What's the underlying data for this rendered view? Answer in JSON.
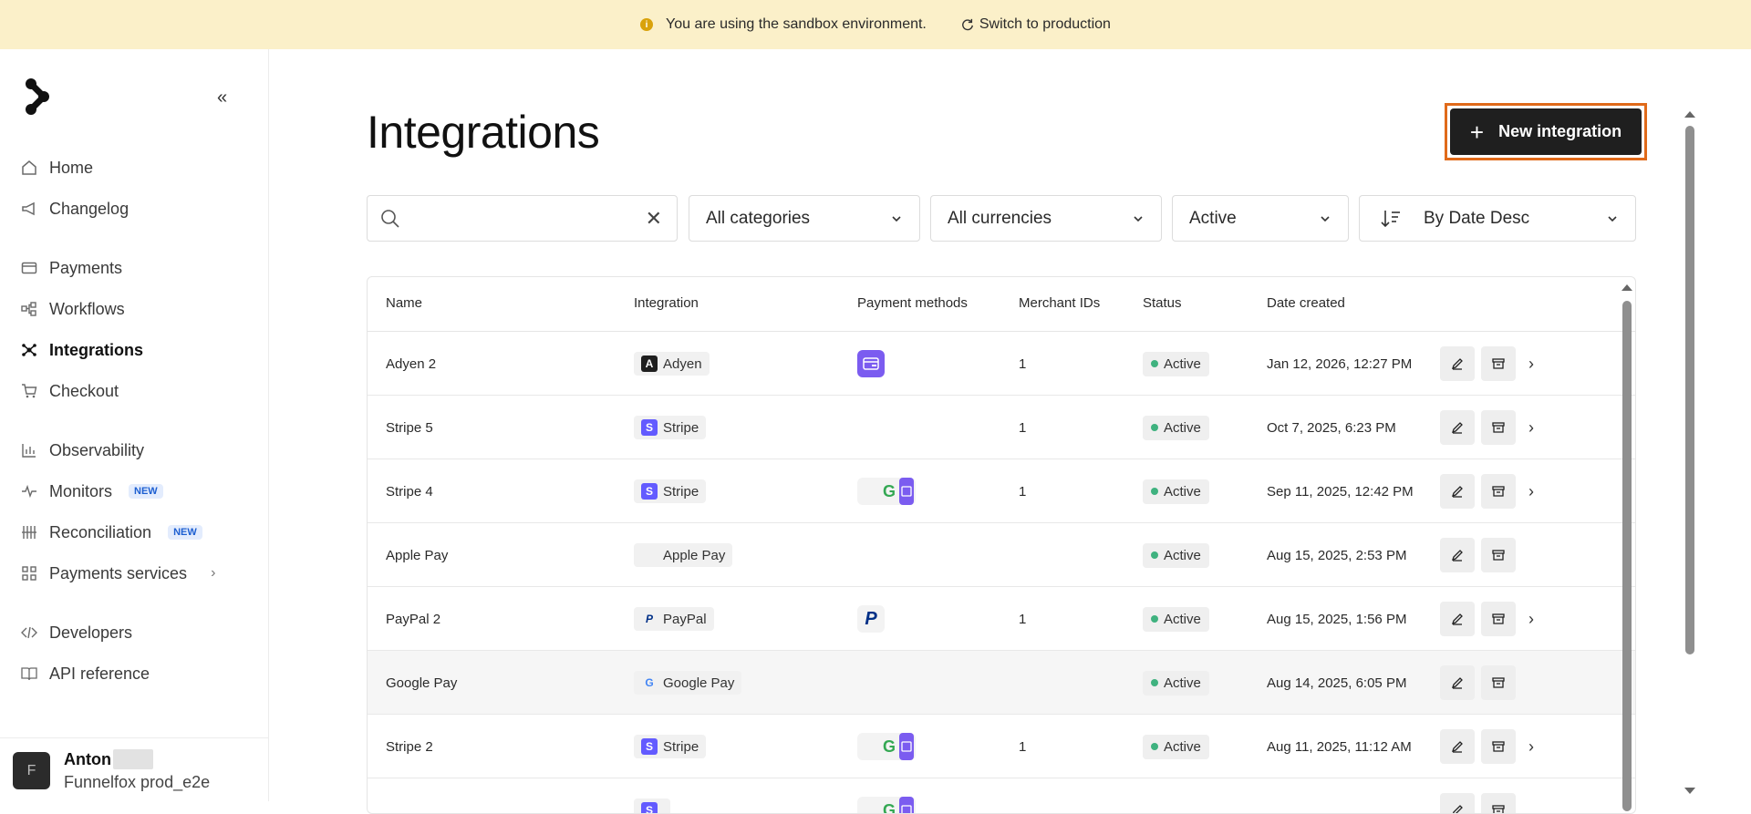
{
  "banner": {
    "message": "You are using the sandbox environment.",
    "switch_label": "Switch to production"
  },
  "sidebar": {
    "items": [
      {
        "label": "Home",
        "icon": "home-icon"
      },
      {
        "label": "Changelog",
        "icon": "megaphone-icon"
      },
      {
        "label": "Payments",
        "icon": "card-icon"
      },
      {
        "label": "Workflows",
        "icon": "workflow-icon"
      },
      {
        "label": "Integrations",
        "icon": "integrations-icon",
        "active": true
      },
      {
        "label": "Checkout",
        "icon": "cart-icon"
      },
      {
        "label": "Observability",
        "icon": "chart-icon"
      },
      {
        "label": "Monitors",
        "icon": "pulse-icon",
        "badge": "NEW"
      },
      {
        "label": "Reconciliation",
        "icon": "reconcile-icon",
        "badge": "NEW"
      },
      {
        "label": "Payments services",
        "icon": "services-icon"
      },
      {
        "label": "Developers",
        "icon": "code-icon"
      },
      {
        "label": "API reference",
        "icon": "book-icon"
      }
    ],
    "user": {
      "name": "Anton",
      "org": "Funnelfox prod_e2e",
      "avatar_letter": "F"
    }
  },
  "page": {
    "title": "Integrations",
    "new_button": "New integration"
  },
  "filters": {
    "search_placeholder": "",
    "category": "All categories",
    "currency": "All currencies",
    "status": "Active",
    "sort": "By Date Desc"
  },
  "table": {
    "headers": [
      "Name",
      "Integration",
      "Payment methods",
      "Merchant IDs",
      "Status",
      "Date created"
    ],
    "rows": [
      {
        "name": "Adyen 2",
        "integration": "Adyen",
        "logo": "A",
        "logo_color": "#1f1f1f",
        "methods": "card",
        "merchant_ids": "1",
        "status": "Active",
        "date": "Jan 12, 2026, 12:27 PM",
        "chevron": true
      },
      {
        "name": "Stripe 5",
        "integration": "Stripe",
        "logo": "S",
        "logo_color": "#635bff",
        "methods": "",
        "merchant_ids": "1",
        "status": "Active",
        "date": "Oct 7, 2025, 6:23 PM",
        "chevron": true
      },
      {
        "name": "Stripe 4",
        "integration": "Stripe",
        "logo": "S",
        "logo_color": "#635bff",
        "methods": "apple-google-card",
        "merchant_ids": "1",
        "status": "Active",
        "date": "Sep 11, 2025, 12:42 PM",
        "chevron": true
      },
      {
        "name": "Apple Pay",
        "integration": "Apple Pay",
        "logo": "",
        "logo_color": "#f1f1f1",
        "methods": "",
        "merchant_ids": "",
        "status": "Active",
        "date": "Aug 15, 2025, 2:53 PM",
        "chevron": false
      },
      {
        "name": "PayPal 2",
        "integration": "PayPal",
        "logo": "P",
        "logo_color": "#f1f1f1",
        "methods": "paypal",
        "merchant_ids": "1",
        "status": "Active",
        "date": "Aug 15, 2025, 1:56 PM",
        "chevron": true
      },
      {
        "name": "Google Pay",
        "integration": "Google Pay",
        "logo": "G",
        "logo_color": "#f1f1f1",
        "methods": "",
        "merchant_ids": "",
        "status": "Active",
        "date": "Aug 14, 2025, 6:05 PM",
        "chevron": false
      },
      {
        "name": "Stripe 2",
        "integration": "Stripe",
        "logo": "S",
        "logo_color": "#635bff",
        "methods": "apple-google-card",
        "merchant_ids": "1",
        "status": "Active",
        "date": "Aug 11, 2025, 11:12 AM",
        "chevron": true
      },
      {
        "name": "",
        "integration": "",
        "logo": "S",
        "logo_color": "#635bff",
        "methods": "apple-google-card",
        "merchant_ids": "",
        "status": "",
        "date": "",
        "chevron": false
      }
    ]
  },
  "colors": {
    "accent_border": "#e06a1a",
    "banner_bg": "#fbf0c9",
    "active_dot": "#3fb27f"
  }
}
